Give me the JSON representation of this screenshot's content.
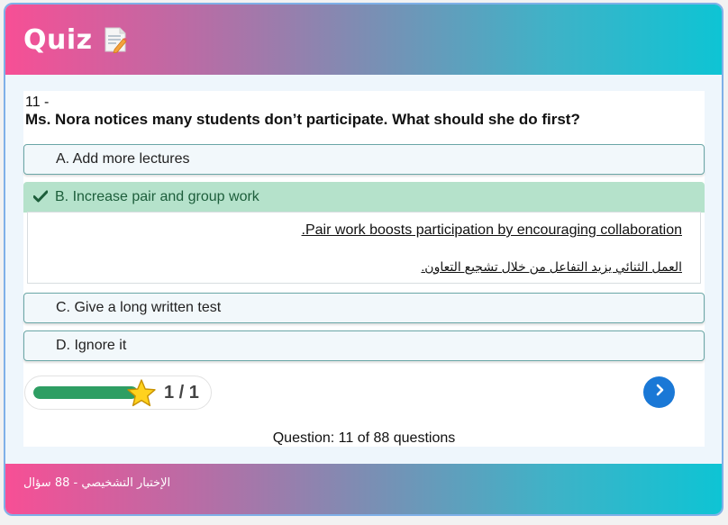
{
  "header": {
    "title": "Quiz",
    "icon": "memo-icon"
  },
  "question": {
    "number": "11 -",
    "text": "Ms. Nora notices many students don’t participate. What should she do first?"
  },
  "options": [
    {
      "label": "A. Add more lectures",
      "state": "default"
    },
    {
      "label": "B. Increase pair and group work",
      "state": "correct"
    },
    {
      "label": "C. Give a long written test",
      "state": "default"
    },
    {
      "label": "D. Ignore it",
      "state": "default"
    }
  ],
  "explanation": {
    "english": "Pair work boosts participation by encouraging collaboration.",
    "arabic": "العمل الثنائي يزيد التفاعل من خلال تشجيع التعاون."
  },
  "progress": {
    "text": "1 / 1",
    "fraction": 1.0
  },
  "counter": "Question: 11 of 88 questions",
  "footer": {
    "text": "الإختبار التشخيصي - 88 سؤال"
  },
  "colors": {
    "correct_bg": "#b5e2cb",
    "correct_text": "#1d5e3b",
    "progress_fill": "#2e9e63",
    "next_button": "#1a78d6",
    "gradient_start": "#f74f95",
    "gradient_end": "#0ec4d4"
  }
}
